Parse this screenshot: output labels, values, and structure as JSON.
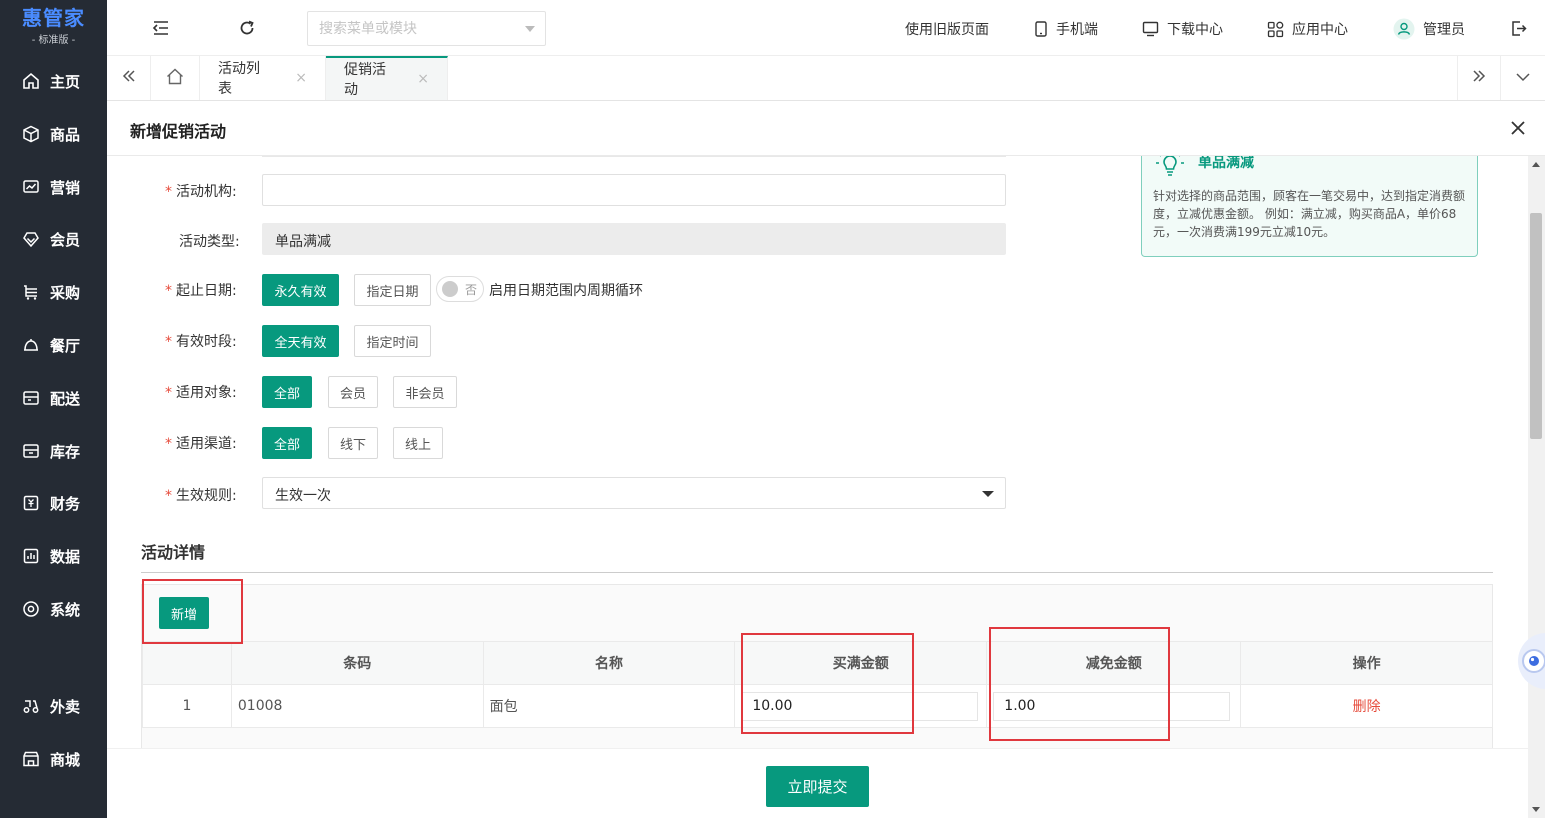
{
  "brand": {
    "name": "惠管家",
    "edition": "- 标准版 -"
  },
  "sidebar": {
    "items": [
      {
        "label": "主页",
        "icon": "home-icon"
      },
      {
        "label": "商品",
        "icon": "box-icon"
      },
      {
        "label": "营销",
        "icon": "chart-icon"
      },
      {
        "label": "会员",
        "icon": "diamond-icon"
      },
      {
        "label": "采购",
        "icon": "cart-icon"
      },
      {
        "label": "餐厅",
        "icon": "cloche-icon"
      },
      {
        "label": "配送",
        "icon": "delivery-icon"
      },
      {
        "label": "库存",
        "icon": "inventory-icon"
      },
      {
        "label": "财务",
        "icon": "finance-icon"
      },
      {
        "label": "数据",
        "icon": "data-icon"
      },
      {
        "label": "系统",
        "icon": "system-icon"
      },
      {
        "label": "外卖",
        "icon": "scooter-icon"
      },
      {
        "label": "商城",
        "icon": "store-icon"
      }
    ]
  },
  "header": {
    "search_placeholder": "搜索菜单或模块",
    "old_version": "使用旧版页面",
    "mobile": "手机端",
    "download": "下载中心",
    "app_center": "应用中心",
    "user": "管理员"
  },
  "tabs": [
    {
      "label": "活动列表"
    },
    {
      "label": "促销活动"
    }
  ],
  "dialog": {
    "title": "新增促销活动",
    "form": {
      "org_label": "活动机构:",
      "org_value": "",
      "type_label": "活动类型:",
      "type_value": "单品满减",
      "date_label": "起止日期:",
      "date_options": [
        "永久有效",
        "指定日期"
      ],
      "cycle_toggle": "否",
      "cycle_desc": "启用日期范围内周期循环",
      "time_label": "有效时段:",
      "time_options": [
        "全天有效",
        "指定时间"
      ],
      "target_label": "适用对象:",
      "target_options": [
        "全部",
        "会员",
        "非会员"
      ],
      "channel_label": "适用渠道:",
      "channel_options": [
        "全部",
        "线下",
        "线上"
      ],
      "rule_label": "生效规则:",
      "rule_value": "生效一次"
    },
    "tip": {
      "title": "单品满减",
      "text": "针对选择的商品范围，顾客在一笔交易中，达到指定消费额度，立减优惠金额。 例如：满立减，购买商品A，单价68元，一次消费满199元立减10元。"
    },
    "details": {
      "title": "活动详情",
      "add_button": "新增",
      "columns": [
        "",
        "条码",
        "名称",
        "买满金额",
        "减免金额",
        "操作"
      ],
      "rows": [
        {
          "index": "1",
          "barcode": "01008",
          "name": "面包",
          "threshold": "10.00",
          "discount": "1.00",
          "action": "删除"
        }
      ]
    },
    "submit": "立即提交"
  },
  "colors": {
    "primary": "#07997e",
    "sidebar": "#252b34",
    "danger": "#e64b3b",
    "highlight": "#e0383e"
  }
}
